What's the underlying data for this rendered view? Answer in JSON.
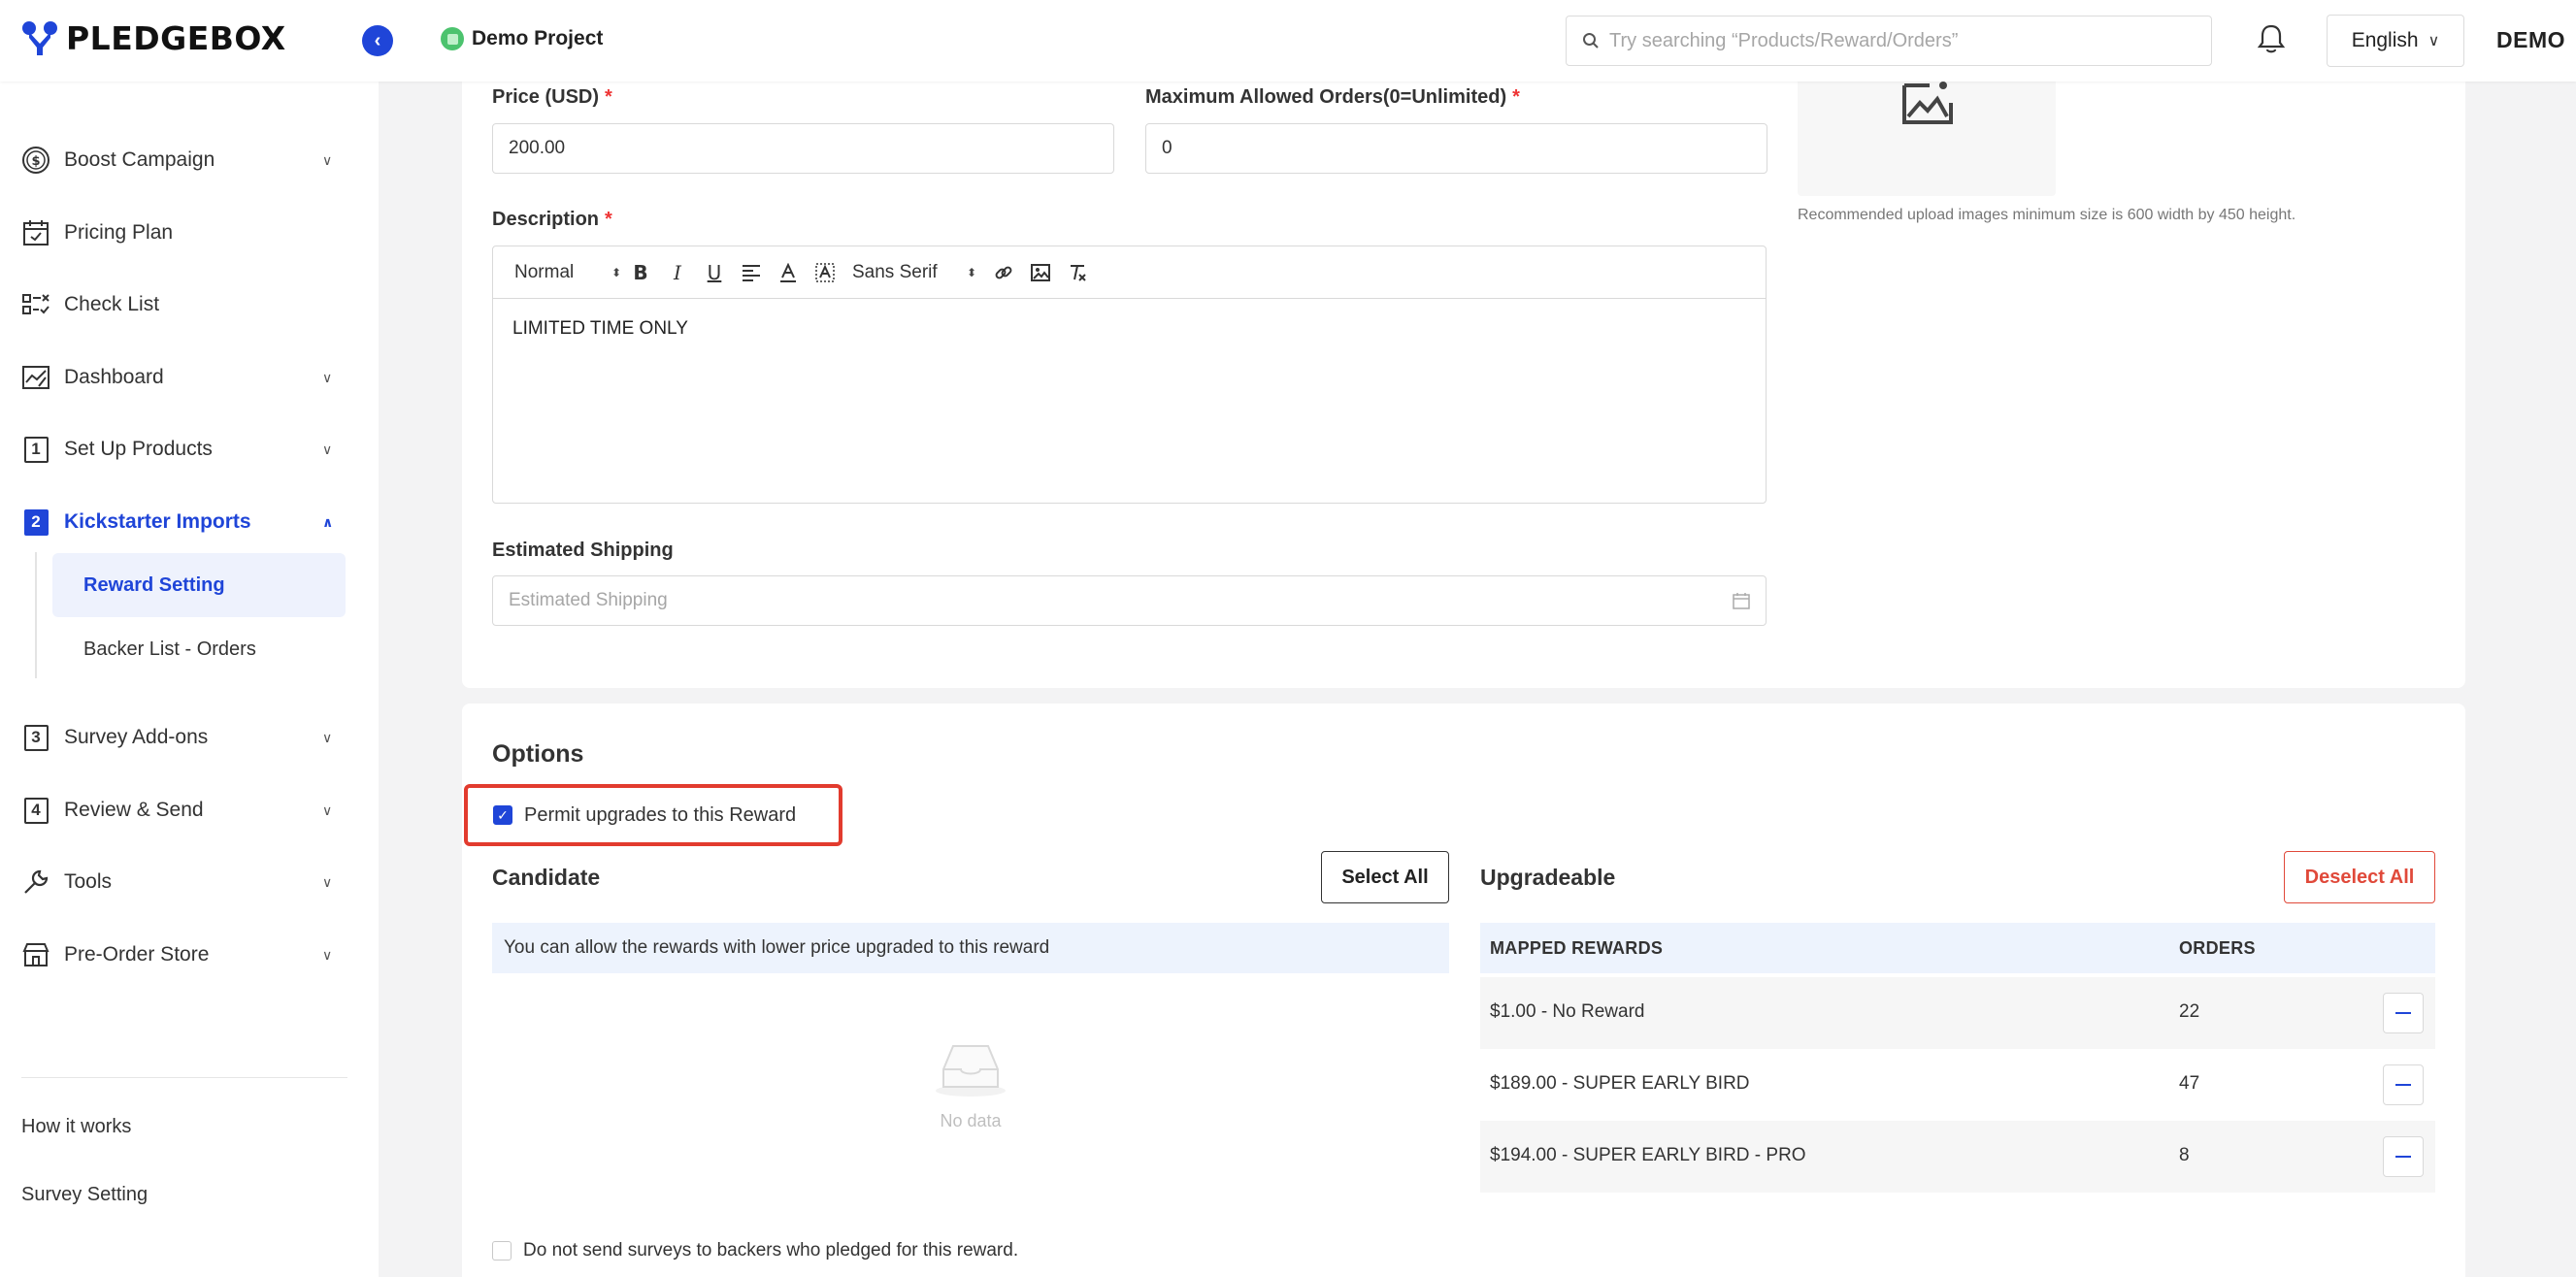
{
  "header": {
    "brand": "PLEDGEBOX",
    "project_name": "Demo Project",
    "search_placeholder": "Try searching “Products/Reward/Orders”",
    "language": "English",
    "user": "DEMO"
  },
  "sidebar": {
    "items": [
      {
        "label": "Boost Campaign",
        "icon": "dollar-circle-icon"
      },
      {
        "label": "Pricing Plan",
        "icon": "calendar-icon"
      },
      {
        "label": "Check List",
        "icon": "checklist-icon"
      },
      {
        "label": "Dashboard",
        "icon": "chart-icon"
      },
      {
        "label": "Set Up Products",
        "icon": "step-1"
      },
      {
        "label": "Kickstarter Imports",
        "icon": "step-2"
      },
      {
        "label": "Survey Add-ons",
        "icon": "step-3"
      },
      {
        "label": "Review & Send",
        "icon": "step-4"
      },
      {
        "label": "Tools",
        "icon": "wrench-icon"
      },
      {
        "label": "Pre-Order Store",
        "icon": "store-icon"
      }
    ],
    "step_numbers": [
      "1",
      "2",
      "3",
      "4"
    ],
    "sub_items": [
      "Reward Setting",
      "Backer List - Orders"
    ],
    "footer_links": [
      "How it works",
      "Survey Setting"
    ]
  },
  "form": {
    "price_label": "Price (USD)",
    "price_value": "200.00",
    "max_orders_label": "Maximum Allowed Orders(0=Unlimited)",
    "max_orders_value": "0",
    "description_label": "Description",
    "toolbar": {
      "header_select": "Normal",
      "font_select": "Sans Serif"
    },
    "description_text": "LIMITED TIME ONLY",
    "shipping_label": "Estimated Shipping",
    "shipping_placeholder": "Estimated Shipping",
    "image_note": "Recommended upload images minimum size is 600 width by 450 height."
  },
  "options": {
    "title": "Options",
    "permit_upgrades_label": "Permit upgrades to this Reward",
    "permit_upgrades_checked": true,
    "candidate_title": "Candidate",
    "select_all_label": "Select All",
    "candidate_info": "You can allow the rewards with lower price upgraded to this reward",
    "no_data": "No data",
    "upgradeable_title": "Upgradeable",
    "deselect_all_label": "Deselect All",
    "columns": [
      "MAPPED REWARDS",
      "ORDERS"
    ],
    "rows": [
      {
        "reward": "$1.00 - No Reward",
        "orders": "22"
      },
      {
        "reward": "$189.00 - SUPER EARLY BIRD",
        "orders": "47"
      },
      {
        "reward": "$194.00 - SUPER EARLY BIRD - PRO",
        "orders": "8"
      }
    ],
    "no_survey_label": "Do not send surveys to backers who pledged for this reward.",
    "no_survey_checked": false
  },
  "colors": {
    "accent": "#1f45d8",
    "danger": "#e0493a",
    "success": "#4cc36e"
  }
}
